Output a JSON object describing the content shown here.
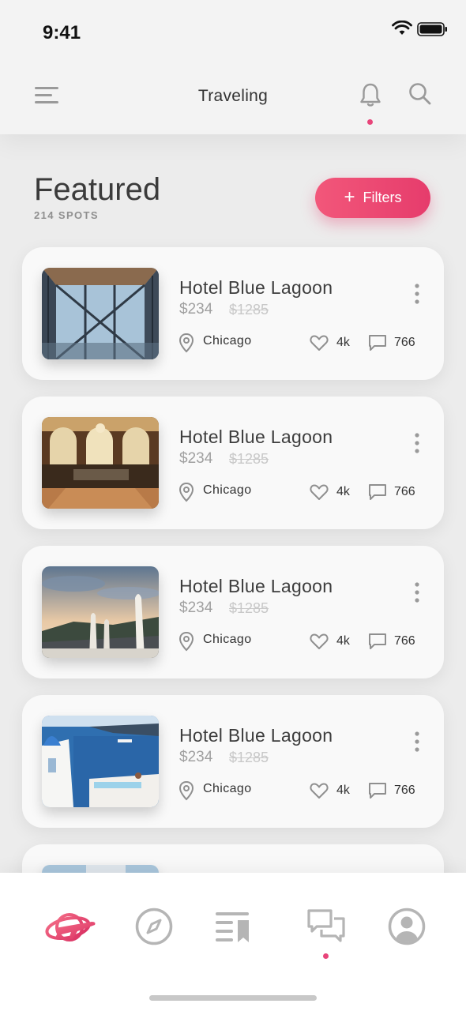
{
  "status": {
    "time": "9:41"
  },
  "nav": {
    "title": "Traveling",
    "accent": "#e8457a"
  },
  "header": {
    "title": "Featured",
    "count": "214 SPOTS",
    "filters_label": "Filters",
    "filters_icon": "plus-icon"
  },
  "cards": [
    {
      "name": "Hotel Blue Lagoon",
      "price": "$234",
      "old_price": "$1285",
      "city": "Chicago",
      "likes": "4k",
      "comments": "766",
      "image": "glass-atrium"
    },
    {
      "name": "Hotel Blue Lagoon",
      "price": "$234",
      "old_price": "$1285",
      "city": "Chicago",
      "likes": "4k",
      "comments": "766",
      "image": "hotel-lobby"
    },
    {
      "name": "Hotel Blue Lagoon",
      "price": "$234",
      "old_price": "$1285",
      "city": "Chicago",
      "likes": "4k",
      "comments": "766",
      "image": "terrace-sunset"
    },
    {
      "name": "Hotel Blue Lagoon",
      "price": "$234",
      "old_price": "$1285",
      "city": "Chicago",
      "likes": "4k",
      "comments": "766",
      "image": "santorini-view"
    }
  ],
  "tabbar": {
    "items": [
      "plane-icon",
      "compass-icon",
      "bookmark-list-icon",
      "chat-icon",
      "profile-icon"
    ],
    "active": "plane-icon",
    "notification": "chat-icon"
  }
}
